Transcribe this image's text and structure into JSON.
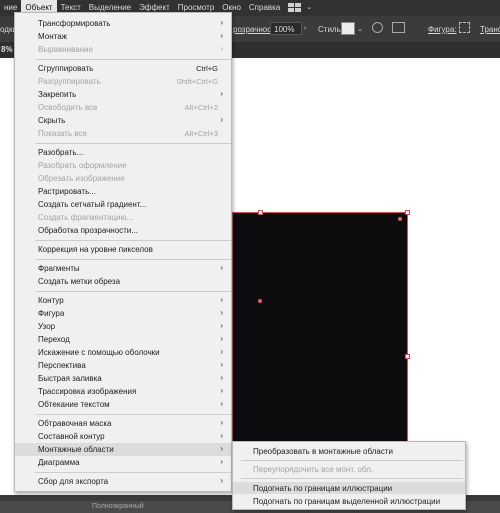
{
  "menubar": {
    "items": [
      "ние",
      "Объект",
      "Текст",
      "Выделение",
      "Эффект",
      "Просмотр",
      "Окно",
      "Справка"
    ]
  },
  "controlbar": {
    "left_label": "одки",
    "opacity_label": "розрачность:",
    "opacity_value": "100%",
    "style_label": "Стиль:",
    "shape_label": "Фигура:",
    "transform_label": "Трансф"
  },
  "tabbar": {
    "zoom_fragment": "8% ("
  },
  "statusbar": {
    "text": "Полноэкранный"
  },
  "object_menu": {
    "items": [
      {
        "label": "Трансформировать",
        "submenu": true,
        "disabled": false
      },
      {
        "label": "Монтаж",
        "submenu": true,
        "disabled": false
      },
      {
        "label": "Выравнивание",
        "submenu": true,
        "disabled": true
      },
      {
        "label": "Сгруппировать",
        "shortcut": "Ctrl+G",
        "disabled": false
      },
      {
        "label": "Разгруппировать",
        "shortcut": "Shift+Ctrl+G",
        "disabled": true
      },
      {
        "label": "Закрепить",
        "submenu": true,
        "disabled": false
      },
      {
        "label": "Освободить все",
        "shortcut": "Alt+Ctrl+2",
        "disabled": true
      },
      {
        "label": "Скрыть",
        "submenu": true,
        "disabled": false
      },
      {
        "label": "Показать все",
        "shortcut": "Alt+Ctrl+3",
        "disabled": true
      },
      {
        "label": "Разобрать...",
        "disabled": false
      },
      {
        "label": "Разобрать оформление",
        "disabled": true
      },
      {
        "label": "Обрезать изображение",
        "disabled": true
      },
      {
        "label": "Растрировать...",
        "disabled": false
      },
      {
        "label": "Создать сетчатый градиент...",
        "disabled": false
      },
      {
        "label": "Создать фрагментацию...",
        "disabled": true
      },
      {
        "label": "Обработка прозрачности...",
        "disabled": false
      },
      {
        "label": "Коррекция на уровне пикселов",
        "disabled": false
      },
      {
        "label": "Фрагменты",
        "submenu": true,
        "disabled": false
      },
      {
        "label": "Создать метки обреза",
        "disabled": false
      },
      {
        "label": "Контур",
        "submenu": true,
        "disabled": false
      },
      {
        "label": "Фигура",
        "submenu": true,
        "disabled": false
      },
      {
        "label": "Узор",
        "submenu": true,
        "disabled": false
      },
      {
        "label": "Переход",
        "submenu": true,
        "disabled": false
      },
      {
        "label": "Искажение с помощью оболочки",
        "submenu": true,
        "disabled": false
      },
      {
        "label": "Перспектива",
        "submenu": true,
        "disabled": false
      },
      {
        "label": "Быстрая заливка",
        "submenu": true,
        "disabled": false
      },
      {
        "label": "Трассировка изображения",
        "submenu": true,
        "disabled": false
      },
      {
        "label": "Обтекание текстом",
        "submenu": true,
        "disabled": false
      },
      {
        "label": "Обтравочная маска",
        "submenu": true,
        "disabled": false
      },
      {
        "label": "Составной контур",
        "submenu": true,
        "disabled": false
      },
      {
        "label": "Монтажные области",
        "submenu": true,
        "disabled": false,
        "highlighted": true
      },
      {
        "label": "Диаграмма",
        "submenu": true,
        "disabled": false
      },
      {
        "label": "Сбор для экспорта",
        "submenu": true,
        "disabled": false
      }
    ]
  },
  "artboards_submenu": {
    "items": [
      {
        "label": "Преобразовать в монтажные области",
        "disabled": false
      },
      {
        "label": "Переупорядочить все монт. обл.",
        "disabled": true
      },
      {
        "label": "Подогнать по границам иллюстрации",
        "disabled": false,
        "highlighted": true
      },
      {
        "label": "Подогнать по границам выделенной иллюстрации",
        "disabled": false
      }
    ]
  },
  "colors": {
    "menubar_bg": "#323232",
    "menu_bg": "#f0f0f0",
    "artwork_fill": "#0c0c0e",
    "selection": "#d24c5a"
  }
}
